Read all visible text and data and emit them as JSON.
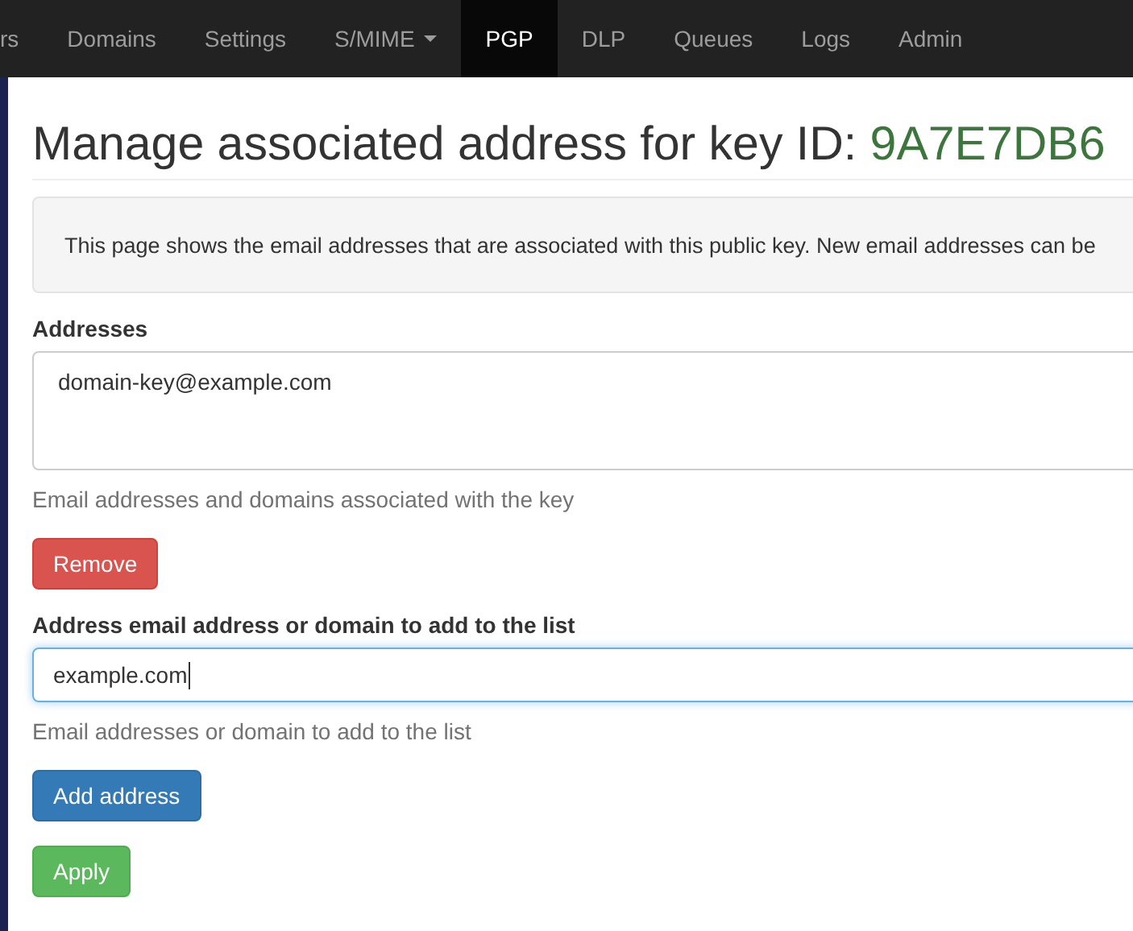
{
  "navbar": {
    "items": [
      {
        "label": "rs",
        "selected": false,
        "dropdown": false
      },
      {
        "label": "Domains",
        "selected": false,
        "dropdown": false
      },
      {
        "label": "Settings",
        "selected": false,
        "dropdown": false
      },
      {
        "label": "S/MIME",
        "selected": false,
        "dropdown": true
      },
      {
        "label": "PGP",
        "selected": true,
        "dropdown": false
      },
      {
        "label": "DLP",
        "selected": false,
        "dropdown": false
      },
      {
        "label": "Queues",
        "selected": false,
        "dropdown": false
      },
      {
        "label": "Logs",
        "selected": false,
        "dropdown": false
      },
      {
        "label": "Admin",
        "selected": false,
        "dropdown": false
      }
    ]
  },
  "heading": {
    "text": "Manage associated address for key ID: ",
    "key_id": "9A7E7DB6"
  },
  "info": "This page shows the email addresses that are associated with this public key. New email addresses can be",
  "addresses": {
    "label": "Addresses",
    "items": [
      "domain-key@example.com"
    ],
    "help": "Email addresses and domains associated with the key"
  },
  "remove_button": "Remove",
  "add": {
    "label": "Address email address or domain to add to the list",
    "value": "example.com",
    "focused": true,
    "help": "Email addresses or domain to add to the list"
  },
  "add_button": "Add address",
  "apply_button": "Apply"
}
